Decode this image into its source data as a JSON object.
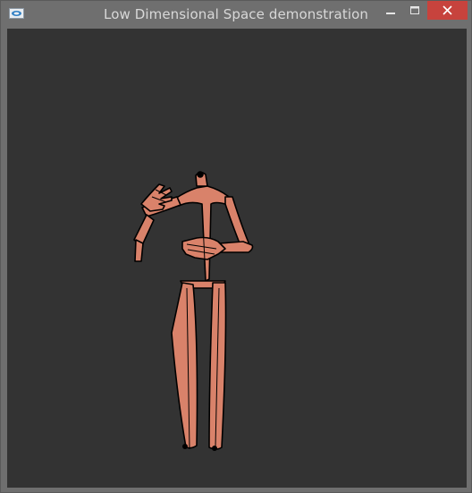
{
  "window": {
    "title": "Low Dimensional Space demonstration"
  },
  "controls": {
    "minimize_icon": "minimize-icon",
    "maximize_icon": "maximize-icon",
    "close_icon": "close-icon"
  },
  "colors": {
    "frame": "#6f6f6f",
    "title_text": "#d8d8d8",
    "close_button": "#c7433d",
    "canvas_background": "#333333",
    "skin": "#d9826a",
    "outline": "#000000"
  }
}
